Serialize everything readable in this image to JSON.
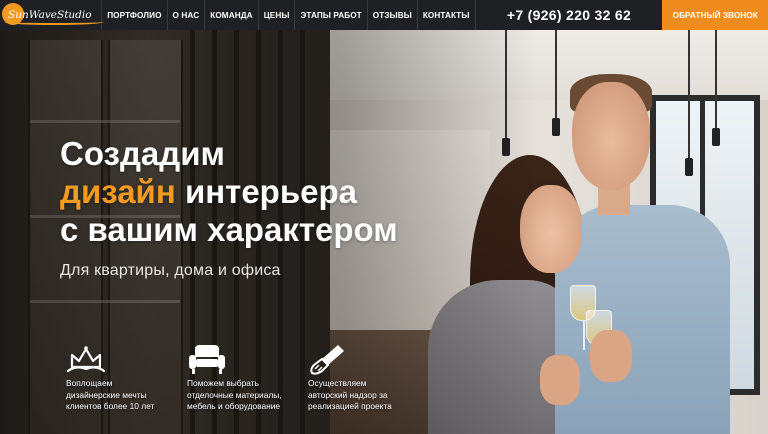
{
  "header": {
    "logo_text": "SunWaveStudio",
    "nav": [
      {
        "label": "ПОРТФОЛИО",
        "name": "nav-portfolio"
      },
      {
        "label": "О НАС",
        "name": "nav-about"
      },
      {
        "label": "КОМАНДА",
        "name": "nav-team"
      },
      {
        "label": "ЦЕНЫ",
        "name": "nav-prices"
      },
      {
        "label": "ЭТАПЫ РАБОТ",
        "name": "nav-stages"
      },
      {
        "label": "ОТЗЫВЫ",
        "name": "nav-reviews"
      },
      {
        "label": "КОНТАКТЫ",
        "name": "nav-contacts"
      }
    ],
    "phone": "+7 (926) 220 32 62",
    "callback_label": "ОБРАТНЫЙ ЗВОНОК"
  },
  "hero": {
    "title_line1": "Создадим",
    "title_accent": "дизайн",
    "title_line2_rest": " интерьера",
    "title_line3": "с вашим характером",
    "subtitle": "Для квартиры, дома и офиса"
  },
  "features": [
    {
      "icon": "crown-hands-icon",
      "lines": [
        "Воплощаем",
        "дизайнерские мечты",
        "клиентов более 10 лет"
      ]
    },
    {
      "icon": "armchair-icon",
      "lines": [
        "Поможем выбрать",
        "отделочные материалы,",
        "мебель и оборудование"
      ]
    },
    {
      "icon": "paint-brush-icon",
      "lines": [
        "Осуществляем",
        "авторский надзор за",
        "реализацией проекта"
      ]
    }
  ],
  "colors": {
    "accent": "#f39a21",
    "header_bg": "#1f2024",
    "callback_bg": "#f08c1e",
    "text_light": "#ffffff"
  }
}
